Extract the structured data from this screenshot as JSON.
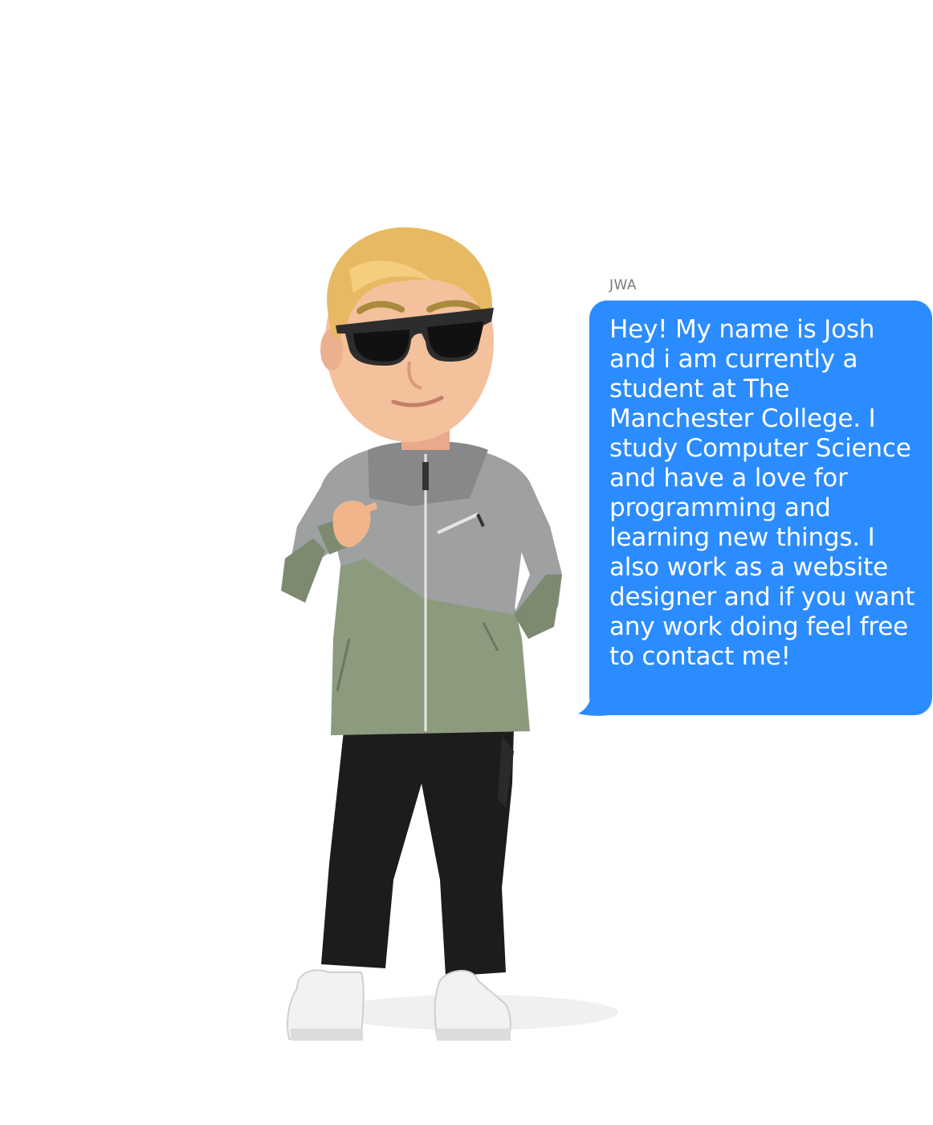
{
  "message": {
    "sender": "JWA",
    "text": "Hey! My name is Josh and i am currently a student at The Manchester College. I study Computer Science and have a love for programming and learning new things. I also work as a website designer and if you want any work doing feel free to contact me!"
  },
  "colors": {
    "bubble": "#2b8cff",
    "bubble_text": "#ffffff",
    "sender": "#7a7a7a",
    "background": "#ffffff"
  },
  "avatar": {
    "icon": "avatar-illustration"
  }
}
